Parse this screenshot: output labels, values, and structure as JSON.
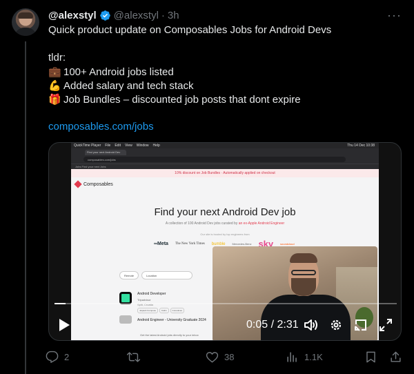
{
  "tweet": {
    "display_name": "@alexstyl",
    "handle": "@alexstyl",
    "separator": "·",
    "time": "3h",
    "more": "···",
    "lines": {
      "intro": "Quick product update on Composables Jobs for Android Devs",
      "tldr": "tldr:",
      "item1_emoji": "💼",
      "item1": "100+ Android jobs listed",
      "item2_emoji": "💪",
      "item2": "Added salary and tech stack",
      "item3_emoji": "🎁",
      "item3": "Job Bundles – discounted job posts that dont expire",
      "link": "composables.com/jobs"
    }
  },
  "video": {
    "time_label": "0:05 / 2:31",
    "progress": 0.033,
    "screen": {
      "menubar": [
        "QuickTime Player",
        "File",
        "Edit",
        "View",
        "Window",
        "Help"
      ],
      "clock": "Thu 14 Dec 10:38",
      "tab": "Find your next Android Dev",
      "url": "composables.com/jobs",
      "bookmarks": "Jobs   Find your next Jobs",
      "promo": "10% discount on Job Bundles · Automatically applied on checkout",
      "brand": "Composables",
      "title": "Find your next Android Dev job",
      "subtitle": "A collection of 100 Android Dev jobs curated by",
      "subtitle_link": "an ex-Apple Android Engineer",
      "trusted": "Our site is trusted by top engineers from",
      "logos": [
        "∞Meta",
        "The New York Times",
        "bumble",
        "Mercedes-Benz",
        "sky",
        "soundcloud"
      ],
      "filter_remote": "Remote",
      "filter_location": "Location",
      "job1": {
        "title": "Android Developer",
        "company": "Tripadvisor",
        "location": "Split, Croatia",
        "tags": [
          "Jetpack Compose",
          "Kotlin",
          "Coroutines"
        ]
      },
      "job2_title": "Android Engineer - University Graduate 2024",
      "get_jobs": "Get the latest Android jobs directly to your inbox"
    }
  },
  "actions": {
    "replies": "2",
    "retweets": "",
    "likes": "38",
    "views": "1.1K"
  },
  "colors": {
    "background": "#000000",
    "text": "#e7e9ea",
    "muted": "#71767b",
    "link": "#1d9bf0",
    "verified": "#1d9bf0",
    "divider": "#333639"
  }
}
